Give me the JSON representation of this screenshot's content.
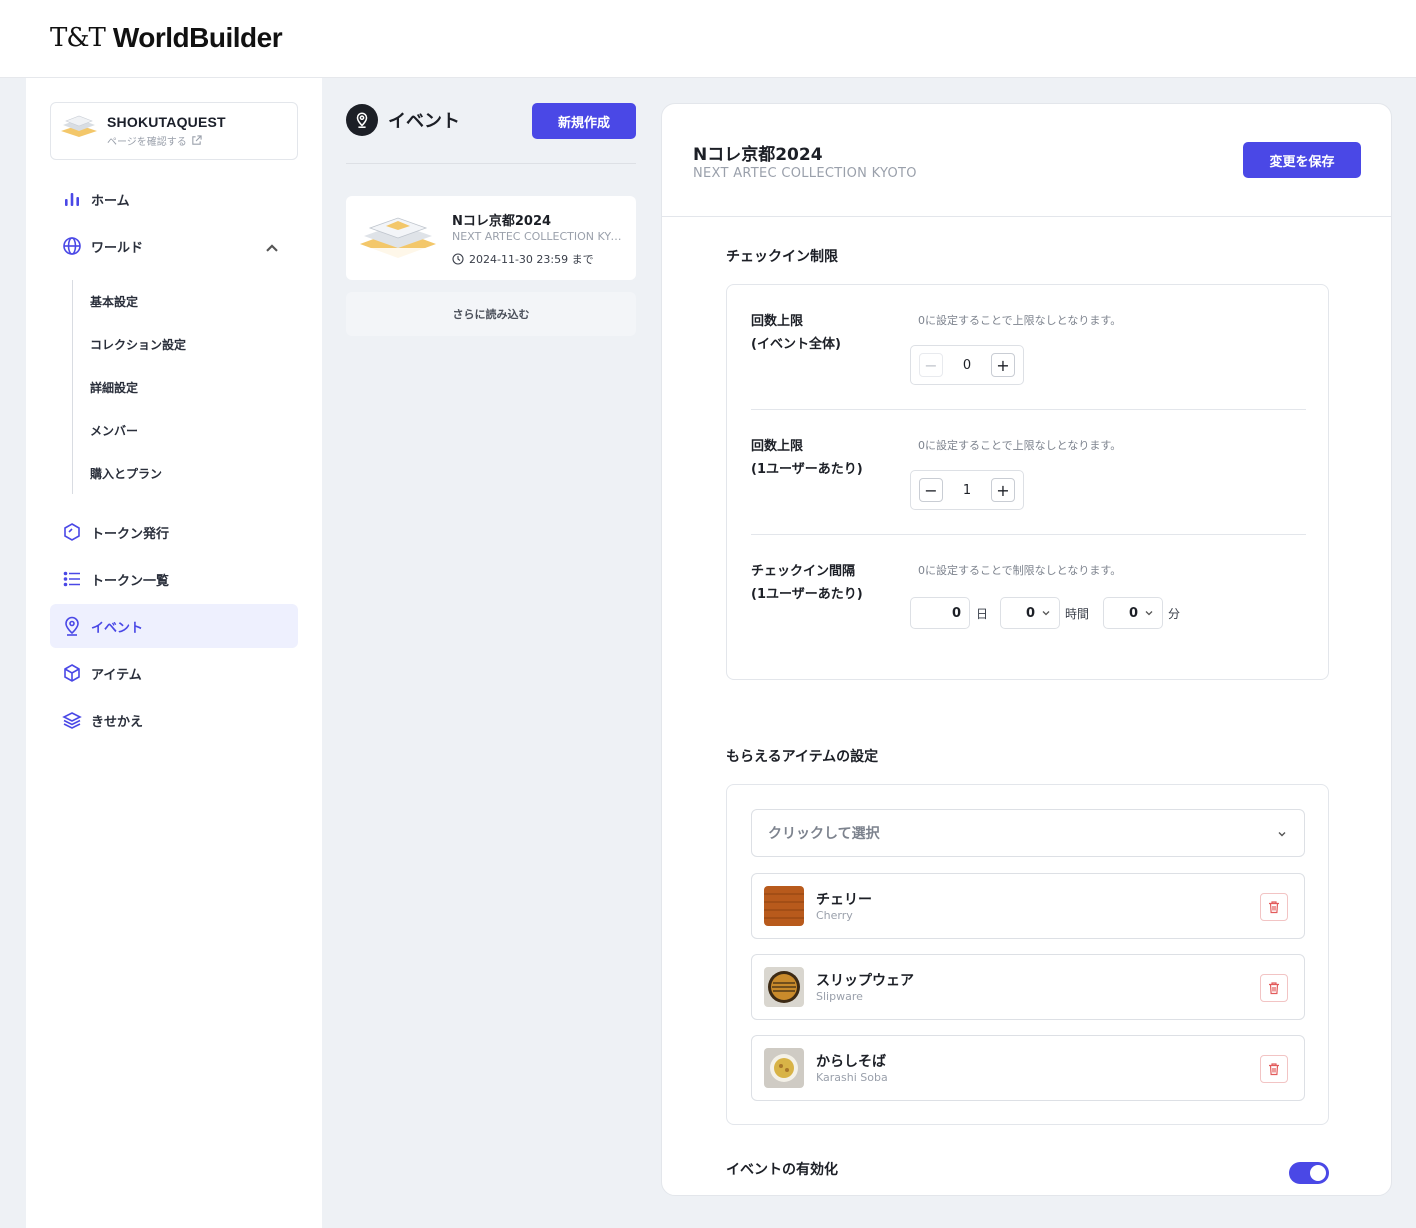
{
  "header": {
    "logo_tt": "T&T",
    "logo_wb": "WorldBuilder"
  },
  "sidebar": {
    "world": {
      "name": "SHOKUTAQUEST",
      "link": "ページを確認する"
    },
    "items": [
      {
        "label": "ホーム"
      },
      {
        "label": "ワールド"
      },
      {
        "label": "トークン発行"
      },
      {
        "label": "トークン一覧"
      },
      {
        "label": "イベント"
      },
      {
        "label": "アイテム"
      },
      {
        "label": "きせかえ"
      }
    ],
    "world_sub": [
      "基本設定",
      "コレクション設定",
      "詳細設定",
      "メンバー",
      "購入とプラン"
    ]
  },
  "events": {
    "title": "イベント",
    "new_button": "新規作成",
    "cards": [
      {
        "title": "Nコレ京都2024",
        "subtitle": "NEXT ARTEC COLLECTION KYOTO",
        "date": "2024-11-30 23:59 まで"
      }
    ],
    "load_more": "さらに読み込む"
  },
  "detail": {
    "title": "Nコレ京都2024",
    "subtitle": "NEXT ARTEC COLLECTION KYOTO",
    "save_button": "変更を保存",
    "checkin": {
      "section_title": "チェックイン制限",
      "rows": [
        {
          "label1": "回数上限",
          "label2": "(イベント全体)",
          "hint": "0に設定することで上限なしとなります。",
          "value": "0"
        },
        {
          "label1": "回数上限",
          "label2": "(1ユーザーあたり)",
          "hint": "0に設定することで上限なしとなります。",
          "value": "1"
        },
        {
          "label1": "チェックイン間隔",
          "label2": "(1ユーザーあたり)",
          "hint": "0に設定することで制限なしとなります。"
        }
      ],
      "interval": {
        "days": "0",
        "days_unit": "日",
        "hours": "0",
        "hours_unit": "時間",
        "minutes": "0",
        "minutes_unit": "分"
      }
    },
    "items": {
      "section_title": "もらえるアイテムの設定",
      "select_placeholder": "クリックして選択",
      "list": [
        {
          "name": "チェリー",
          "en": "Cherry"
        },
        {
          "name": "スリップウェア",
          "en": "Slipware"
        },
        {
          "name": "からしそば",
          "en": "Karashi Soba"
        }
      ]
    },
    "enable": {
      "label": "イベントの有効化",
      "on": true
    },
    "colors": {
      "accent": "#4a48e6",
      "danger": "#e25b5b"
    }
  }
}
